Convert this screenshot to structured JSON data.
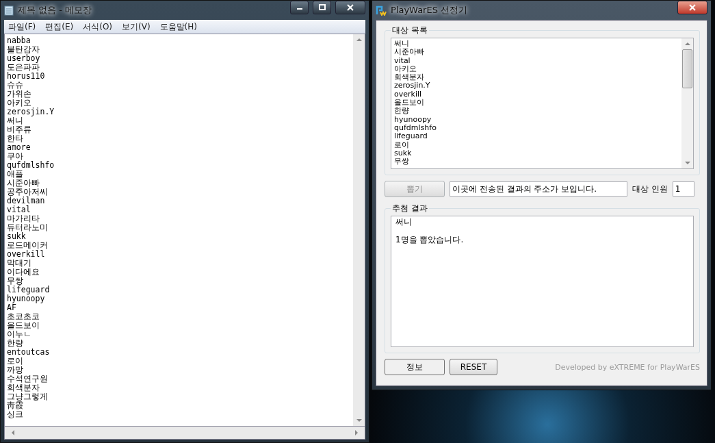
{
  "notepad": {
    "title": "제목 없음 - 메모장",
    "menu": [
      "파일(F)",
      "편집(E)",
      "서식(O)",
      "보기(V)",
      "도움말(H)"
    ],
    "lines": [
      "nabba",
      "불탄감자",
      "userboy",
      "도은파파",
      "horus110",
      "슈슈",
      "가위손",
      "아키오",
      "zerosjin.Y",
      "써니",
      "비주류",
      "한타",
      "amore",
      "쿠아",
      "qufdmlshfo",
      "애플",
      "시준아빠",
      "공주아저씨",
      "devilman",
      "vital",
      "마가리타",
      "듀터라노미",
      "sukk",
      "로드메이커",
      "overkill",
      "막대기",
      "이다에요",
      "무쌍",
      "lifeguard",
      "hyunoopy",
      "AF",
      "초코초코",
      "올드보이",
      "이누ㄴ",
      "한량",
      "entoutcas",
      "로이",
      "까망",
      "수석연구원",
      "회색분자",
      "그냥그렇게",
      "靑霞",
      "싱크"
    ]
  },
  "selector": {
    "title": "PlayWarES 선정기",
    "target_list": {
      "label": "대상 목록",
      "items": [
        "써니",
        "시준아빠",
        "vital",
        "아키오",
        "회색분자",
        "zerosjin.Y",
        "overkill",
        "올드보이",
        "한량",
        "hyunoopy",
        "qufdmlshfo",
        "lifeguard",
        "로이",
        "sukk",
        "무쌍"
      ]
    },
    "draw_button": {
      "label": "뽑기",
      "disabled": true
    },
    "address_field": {
      "value": "이곳에 전송된 결과의 주소가 보입니다."
    },
    "count_label": "대상 인원",
    "count_field": {
      "value": "1"
    },
    "result": {
      "label": "추첨 결과",
      "winner": "써니",
      "message": "1명을 뽑았습니다."
    },
    "info_button": "정보",
    "reset_button": "RESET",
    "credit": "Developed by eXTREME for PlayWarES"
  }
}
